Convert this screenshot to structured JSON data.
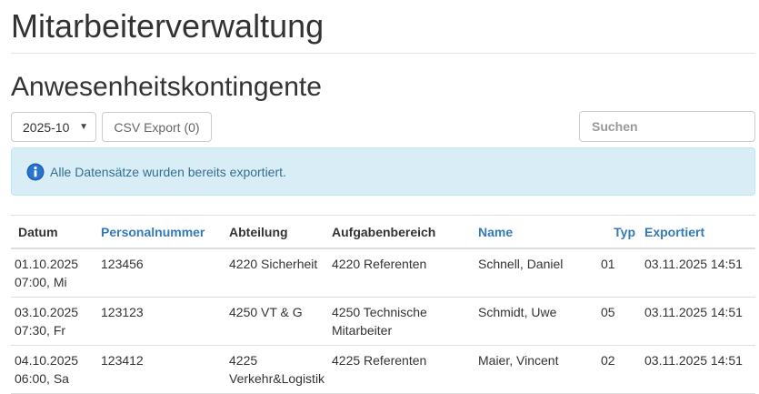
{
  "header": {
    "title": "Mitarbeiterverwaltung",
    "section_title": "Anwesenheitskontingente"
  },
  "toolbar": {
    "month_select": {
      "selected": "2025-10",
      "icon": "chevron-down-icon"
    },
    "csv_export_label": "CSV Export (0)",
    "search_placeholder": "Suchen"
  },
  "alert": {
    "icon": "info-icon",
    "text": "Alle Datensätze wurden bereits exportiert.",
    "color": "#31708f",
    "background": "#d9edf7"
  },
  "table": {
    "columns": [
      {
        "label": "Datum",
        "sortable": false
      },
      {
        "label": "Personalnummer",
        "sortable": true
      },
      {
        "label": "Abteilung",
        "sortable": false
      },
      {
        "label": "Aufgabenbereich",
        "sortable": false
      },
      {
        "label": "Name",
        "sortable": true
      },
      {
        "label": "Typ",
        "sortable": true
      },
      {
        "label": "Exportiert",
        "sortable": true
      }
    ],
    "rows": [
      {
        "datum": "01.10.2025",
        "zeit": "07:00, Mi",
        "personalnummer": "123456",
        "abteilung": "4220 Sicherheit",
        "aufgabenbereich": "4220 Referenten",
        "name": "Schnell, Daniel",
        "typ": "01",
        "exportiert": "03.11.2025 14:51"
      },
      {
        "datum": "03.10.2025",
        "zeit": "07:30, Fr",
        "personalnummer": "123123",
        "abteilung": "4250 VT & G",
        "aufgabenbereich": "4250 Technische Mitarbeiter",
        "name": "Schmidt, Uwe",
        "typ": "05",
        "exportiert": "03.11.2025 14:51"
      },
      {
        "datum": "04.10.2025",
        "zeit": "06:00, Sa",
        "personalnummer": "123412",
        "abteilung": "4225 Verkehr&Logistik",
        "aufgabenbereich": "4225 Referenten",
        "name": "Maier, Vincent",
        "typ": "02",
        "exportiert": "03.11.2025 14:51"
      }
    ]
  },
  "colors": {
    "link": "#337ab7",
    "text": "#333333",
    "border": "#dddddd"
  }
}
